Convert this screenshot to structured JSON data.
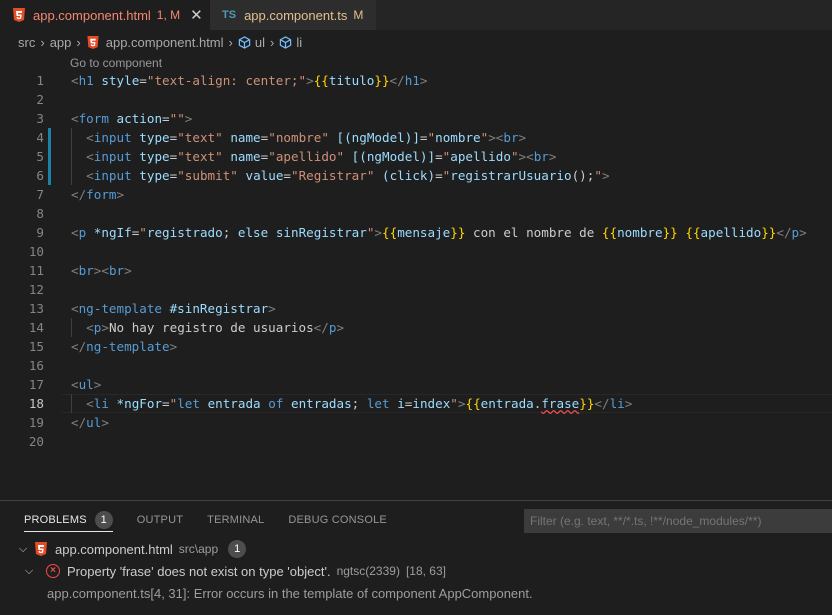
{
  "tabs": [
    {
      "name": "app.component.html",
      "status": "1, M",
      "active": true
    },
    {
      "name": "app.component.ts",
      "status": "M",
      "active": false,
      "icon_text": "TS"
    }
  ],
  "breadcrumb": {
    "items": [
      "src",
      "app",
      "app.component.html",
      "ul",
      "li"
    ]
  },
  "editor": {
    "codelens": "Go to component",
    "current_line": 18
  },
  "panel": {
    "tabs": [
      "PROBLEMS",
      "OUTPUT",
      "TERMINAL",
      "DEBUG CONSOLE"
    ],
    "problems_count": "1",
    "filter_placeholder": "Filter (e.g. text, **/*.ts, !**/node_modules/**)",
    "file_row": {
      "name": "app.component.html",
      "path": "src\\app",
      "count": "1"
    },
    "error": {
      "message": "Property 'frase' does not exist on type 'object'.",
      "source": "ngtsc(2339)",
      "position": "[18, 63]"
    },
    "related": "app.component.ts[4, 31]: Error occurs in the template of component AppComponent."
  },
  "colors": {
    "tag": "#569cd6",
    "attr": "#9cdcfe",
    "string": "#ce9178",
    "bracket": "#ffd700",
    "error": "#f14c4c",
    "modified": "#e2c08d"
  }
}
